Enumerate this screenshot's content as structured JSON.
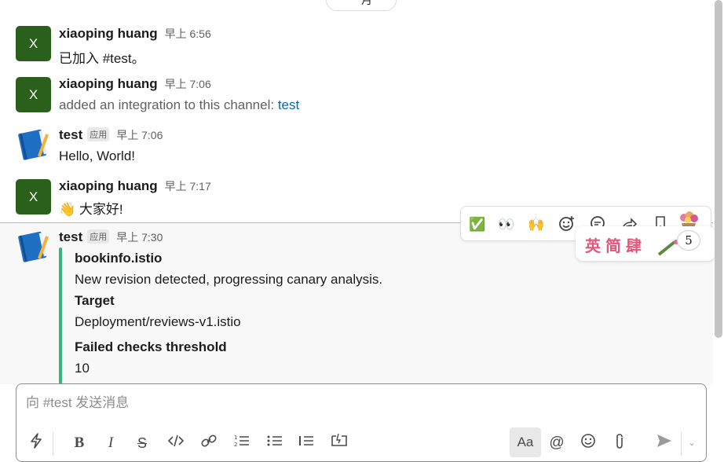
{
  "date_divider": "一月",
  "messages": [
    {
      "author": "xiaoping huang",
      "avatar": "X",
      "time": "早上 6:56",
      "text": "已加入 #test。"
    },
    {
      "author": "xiaoping huang",
      "avatar": "X",
      "time": "早上 7:06",
      "text": "added an integration to this channel: ",
      "link": "test"
    },
    {
      "author": "test",
      "badge": "应用",
      "time": "早上 7:06",
      "text": "Hello, World!"
    },
    {
      "author": "xiaoping huang",
      "avatar": "X",
      "time": "早上 7:17",
      "emoji": "👋",
      "text": "大家好!"
    },
    {
      "author": "test",
      "badge": "应用",
      "time": "早上 7:30",
      "attachment": {
        "title": "bookinfo.istio",
        "description": "New revision detected, progressing canary analysis.",
        "field1_label": "Target",
        "field1_value": "Deployment/reviews-v1.istio",
        "field2_label": "Failed checks threshold",
        "field2_value": "10"
      }
    }
  ],
  "message_actions": {
    "check": "✅",
    "eyes": "👀",
    "raised_hands": "🙌",
    "add_reaction_icon": "smile-plus-icon",
    "thread_icon": "speech-bubble-icon",
    "share_icon": "share-arrow-icon",
    "bookmark_icon": "bookmark-icon"
  },
  "sticker": {
    "text": "英简肆",
    "count": "5"
  },
  "composer": {
    "placeholder": "向 #test 发送消息",
    "aa_label": "Aa"
  },
  "colors": {
    "accent_green": "#36b37e",
    "avatar_green": "#2a5f1c",
    "link": "#1264a3"
  }
}
